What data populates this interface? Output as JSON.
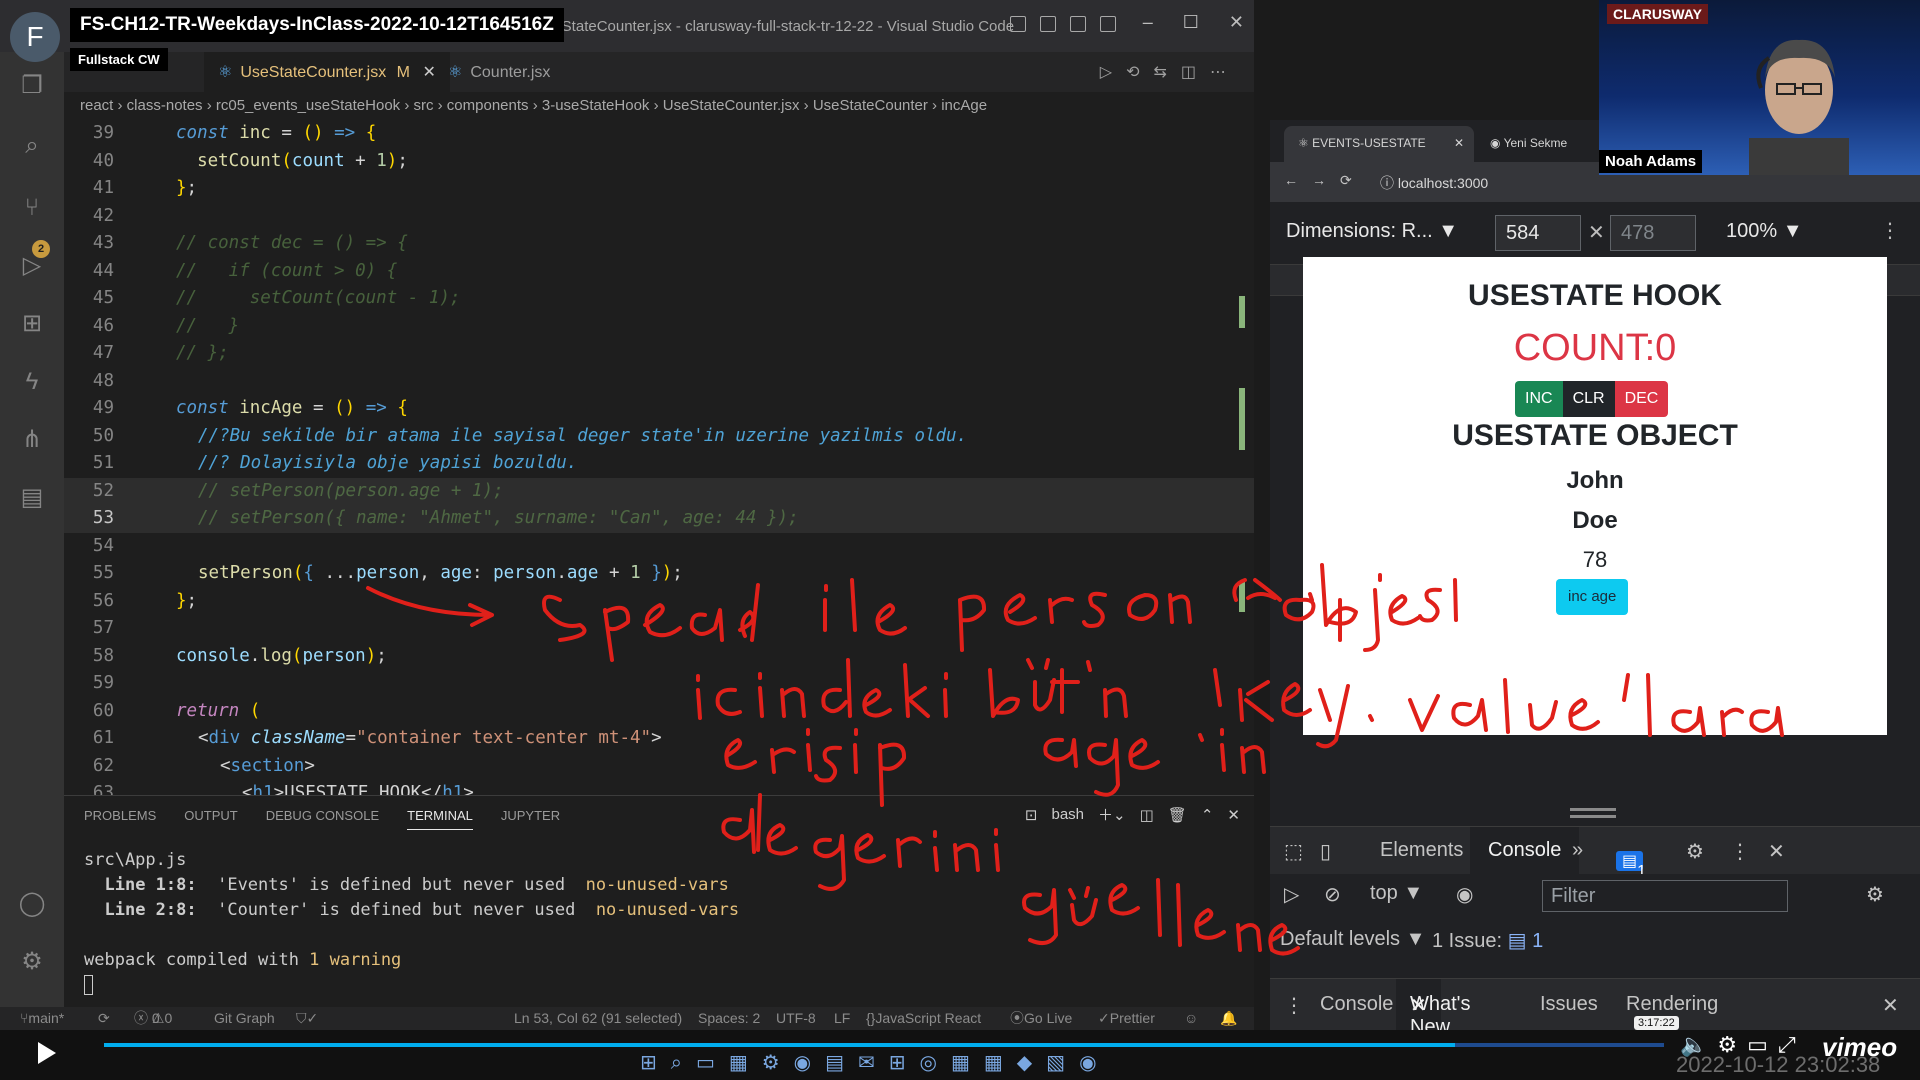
{
  "overlay": {
    "title": "FS-CH12-TR-Weekdays-InClass-2022-10-12T164516Z",
    "subtitle": "Fullstack CW",
    "avatar_letter": "F"
  },
  "window": {
    "title": "UseStateCounter.jsx - clarusway-full-stack-tr-12-22 - Visual Studio Code"
  },
  "tabs": [
    {
      "label": "UseStateCounter.jsx",
      "modified": "M"
    },
    {
      "label": "Counter.jsx"
    }
  ],
  "breadcrumb": "react › class-notes › rc05_events_useStateHook › src › components › 3-useStateHook › UseStateCounter.jsx › UseStateCounter › incAge",
  "scm_badge": "2",
  "code": {
    "l39": "39",
    "l40": "40",
    "l41": "41",
    "l42": "42",
    "l43": "43",
    "l44": "44",
    "l45": "45",
    "l46": "46",
    "l47": "47",
    "l48": "48",
    "l49": "49",
    "l50": "50",
    "l51": "51",
    "l52": "52",
    "l53": "53",
    "l54": "54",
    "l55": "55",
    "l56": "56",
    "l57": "57",
    "l58": "58",
    "l59": "59",
    "l60": "60",
    "l61": "61",
    "l62": "62",
    "l63": "63",
    "c50": "//?Bu sekilde bir atama ile sayisal deger state'in uzerine yazilmis oldu.",
    "c51": "//? Dolayisiyla obje yapisi bozuldu.",
    "c43": "// const dec = () => {",
    "c44": "//   if (count > 0) {",
    "c45": "//     setCount(count - 1);",
    "c46": "//   }",
    "c47": "// };",
    "c52": "// setPerson(person.age + 1);",
    "c53": "// setPerson({ name: \"Ahmet\", surname: \"Can\", age: 44 });"
  },
  "panel": {
    "tabs": [
      "PROBLEMS",
      "OUTPUT",
      "DEBUG CONSOLE",
      "TERMINAL",
      "JUPYTER"
    ],
    "shell": "bash",
    "terminal": {
      "file": "src\\App.js",
      "w1_loc": "Line 1:8:",
      "w1_msg": "'Events' is defined but never used",
      "w1_rule": "no-unused-vars",
      "w2_loc": "Line 2:8:",
      "w2_msg": "'Counter' is defined but never used",
      "w2_rule": "no-unused-vars",
      "compiled_pre": "webpack compiled with ",
      "compiled_num": "1 warning"
    }
  },
  "statusbar": {
    "branch": "main*",
    "errors": "0",
    "warnings": "0",
    "git_graph": "Git Graph",
    "position": "Ln 53, Col 62 (91 selected)",
    "spaces": "Spaces: 2",
    "encoding": "UTF-8",
    "eol": "LF",
    "language": "JavaScript React",
    "golive": "Go Live",
    "prettier": "Prettier"
  },
  "browser": {
    "tab_active": "EVENTS-USESTATE",
    "tab_other": "Yeni Sekme",
    "url": "localhost:3000",
    "dimensions_label": "Dimensions: R...",
    "width": "584",
    "height": "478",
    "zoom": "100%"
  },
  "page": {
    "h1": "USESTATE HOOK",
    "count": "COUNT:0",
    "btn_inc": "INC",
    "btn_clr": "CLR",
    "btn_dec": "DEC",
    "h2": "USESTATE OBJECT",
    "name": "John",
    "surname": "Doe",
    "age": "78",
    "btn_age": "inc age"
  },
  "devtools": {
    "tab_elements": "Elements",
    "tab_console": "Console",
    "more": "»",
    "msg_count": "1",
    "context": "top",
    "filter_placeholder": "Filter",
    "levels": "Default levels",
    "issues": "1 Issue:",
    "issues_count": "1",
    "drawer_console": "Console",
    "drawer_whatsnew": "What's New",
    "drawer_issues": "Issues",
    "drawer_rendering": "Rendering"
  },
  "webcam": {
    "logo": "CLARUSWAY",
    "name": "Noah Adams"
  },
  "player": {
    "timecode": "3:17:22",
    "progress_fraction": 0.866,
    "brand": "vimeo",
    "date": "2022-10-12 23:02:38"
  },
  "colors": {
    "accent": "#007acc",
    "annotation": "#e0201a"
  }
}
